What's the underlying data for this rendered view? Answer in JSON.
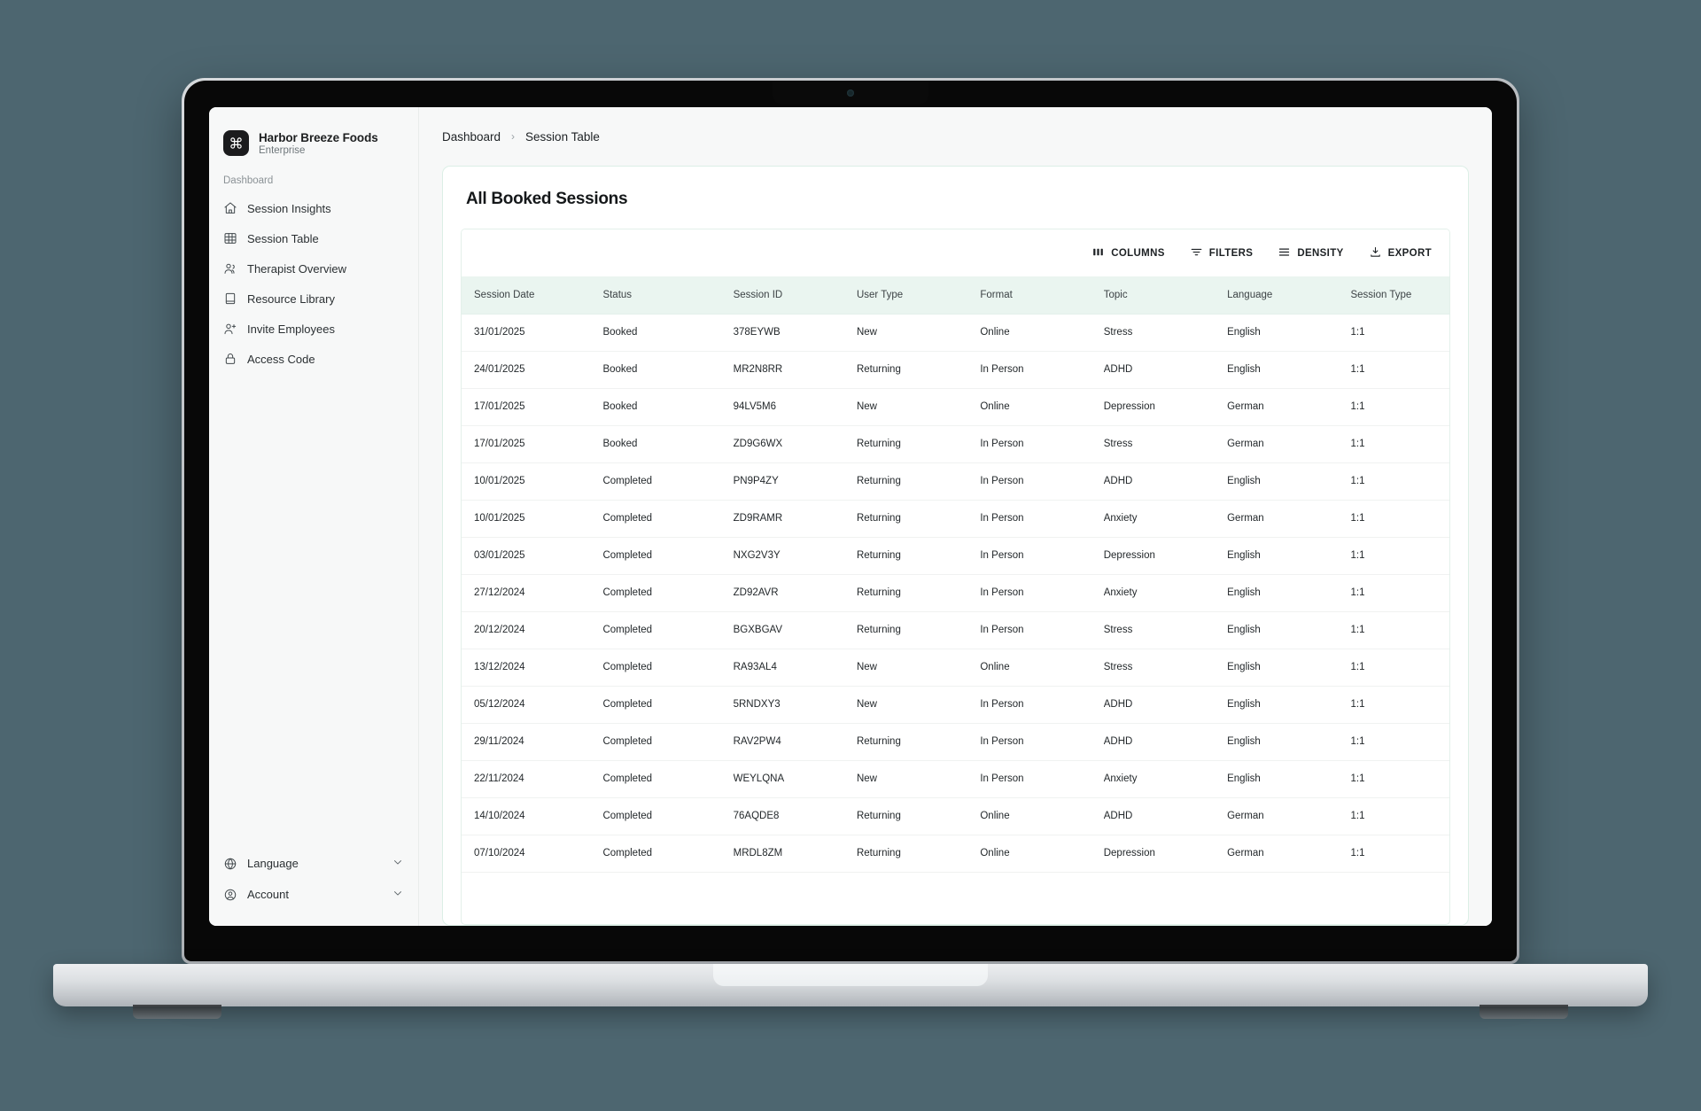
{
  "brand": {
    "logo_icon": "command-icon",
    "name": "Harbor Breeze Foods",
    "plan": "Enterprise"
  },
  "sidebar": {
    "section_label": "Dashboard",
    "items": [
      {
        "label": "Session Insights",
        "icon": "home-icon"
      },
      {
        "label": "Session Table",
        "icon": "table-icon"
      },
      {
        "label": "Therapist Overview",
        "icon": "users-icon"
      },
      {
        "label": "Resource Library",
        "icon": "book-icon"
      },
      {
        "label": "Invite Employees",
        "icon": "user-plus-icon"
      },
      {
        "label": "Access Code",
        "icon": "lock-icon"
      }
    ],
    "bottom_items": [
      {
        "label": "Language",
        "icon": "globe-icon",
        "chevron": "chevron-down-icon"
      },
      {
        "label": "Account",
        "icon": "user-circle-icon",
        "chevron": "chevron-down-icon"
      }
    ]
  },
  "breadcrumb": {
    "root": "Dashboard",
    "separator": "›",
    "current": "Session Table"
  },
  "page": {
    "title": "All Booked Sessions"
  },
  "toolbar": {
    "columns": "COLUMNS",
    "filters": "FILTERS",
    "density": "DENSITY",
    "export": "EXPORT"
  },
  "table": {
    "columns": [
      "Session Date",
      "Status",
      "Session ID",
      "User Type",
      "Format",
      "Topic",
      "Language",
      "Session Type"
    ],
    "rows": [
      [
        "31/01/2025",
        "Booked",
        "378EYWB",
        "New",
        "Online",
        "Stress",
        "English",
        "1:1"
      ],
      [
        "24/01/2025",
        "Booked",
        "MR2N8RR",
        "Returning",
        "In Person",
        "ADHD",
        "English",
        "1:1"
      ],
      [
        "17/01/2025",
        "Booked",
        "94LV5M6",
        "New",
        "Online",
        "Depression",
        "German",
        "1:1"
      ],
      [
        "17/01/2025",
        "Booked",
        "ZD9G6WX",
        "Returning",
        "In Person",
        "Stress",
        "German",
        "1:1"
      ],
      [
        "10/01/2025",
        "Completed",
        "PN9P4ZY",
        "Returning",
        "In Person",
        "ADHD",
        "English",
        "1:1"
      ],
      [
        "10/01/2025",
        "Completed",
        "ZD9RAMR",
        "Returning",
        "In Person",
        "Anxiety",
        "German",
        "1:1"
      ],
      [
        "03/01/2025",
        "Completed",
        "NXG2V3Y",
        "Returning",
        "In Person",
        "Depression",
        "English",
        "1:1"
      ],
      [
        "27/12/2024",
        "Completed",
        "ZD92AVR",
        "Returning",
        "In Person",
        "Anxiety",
        "English",
        "1:1"
      ],
      [
        "20/12/2024",
        "Completed",
        "BGXBGAV",
        "Returning",
        "In Person",
        "Stress",
        "English",
        "1:1"
      ],
      [
        "13/12/2024",
        "Completed",
        "RA93AL4",
        "New",
        "Online",
        "Stress",
        "English",
        "1:1"
      ],
      [
        "05/12/2024",
        "Completed",
        "5RNDXY3",
        "New",
        "In Person",
        "ADHD",
        "English",
        "1:1"
      ],
      [
        "29/11/2024",
        "Completed",
        "RAV2PW4",
        "Returning",
        "In Person",
        "ADHD",
        "English",
        "1:1"
      ],
      [
        "22/11/2024",
        "Completed",
        "WEYLQNA",
        "New",
        "In Person",
        "Anxiety",
        "English",
        "1:1"
      ],
      [
        "14/10/2024",
        "Completed",
        "76AQDE8",
        "Returning",
        "Online",
        "ADHD",
        "German",
        "1:1"
      ],
      [
        "07/10/2024",
        "Completed",
        "MRDL8ZM",
        "Returning",
        "Online",
        "Depression",
        "German",
        "1:1"
      ]
    ]
  },
  "colors": {
    "page_background": "#4d6670",
    "sidebar_background": "#f7f8f8",
    "card_border": "#dcefe6",
    "table_header_background": "#eaf5f0",
    "text_primary": "#1d2124"
  }
}
